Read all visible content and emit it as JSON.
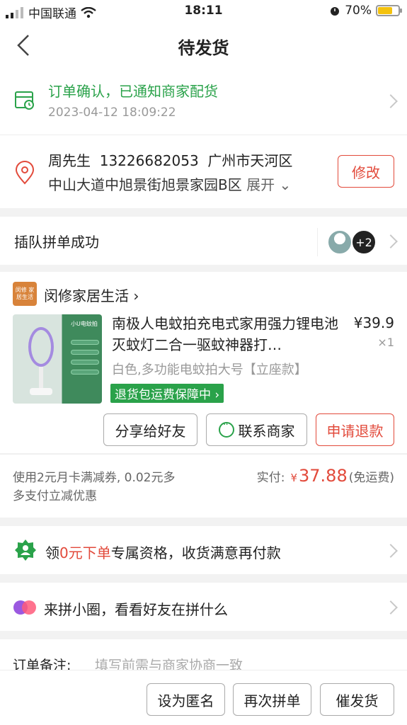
{
  "status_bar": {
    "carrier": "中国联通",
    "time": "18:11",
    "battery": "70%",
    "battery_level": 0.7
  },
  "nav": {
    "title": "待发货"
  },
  "order_status": {
    "message": "订单确认，已通知商家配货",
    "timestamp": "2023-04-12 18:09:22"
  },
  "address": {
    "name": "周先生",
    "phone": "13226682053",
    "city": "广州市天河区",
    "line2": "中山大道中旭景街旭景家园B区",
    "expand": "展开",
    "edit_button": "修改"
  },
  "group": {
    "label": "插队拼单成功",
    "more_count": "+2"
  },
  "store": {
    "logo_text": "闵修 家居生活",
    "name": "闵修家居生活",
    "chevron": "›"
  },
  "product": {
    "title": "南极人电蚊拍充电式家用强力锂电池灭蚊灯二合一驱蚊神器打…",
    "price": "¥39.9",
    "quantity": "×1",
    "spec": "白色,多功能电蚊拍大号【立座款】",
    "badge": "退货包运费保障中",
    "image_label": "小U电蚊拍"
  },
  "actions": {
    "share": "分享给好友",
    "contact": "联系商家",
    "refund": "申请退款"
  },
  "payment": {
    "discount_note": "使用2元月卡满减券, 0.02元多多支付立减优惠",
    "paid_label": "实付:",
    "currency": "¥",
    "amount": "37.88",
    "shipping": "(免运费)"
  },
  "promo_zero": {
    "prefix": "领",
    "highlight": "0元下单",
    "suffix": "专属资格，收货满意再付款"
  },
  "promo_circle": {
    "text": "来拼小圈，看看好友在拼什么"
  },
  "remark": {
    "label": "订单备注:",
    "placeholder": "填写前需与商家协商一致"
  },
  "bottom_bar": {
    "anonymous": "设为匿名",
    "buy_again": "再次拼单",
    "urge": "催发货"
  },
  "colors": {
    "green": "#2aa24a",
    "red": "#e24a3b",
    "battery": "#f4c20d"
  }
}
